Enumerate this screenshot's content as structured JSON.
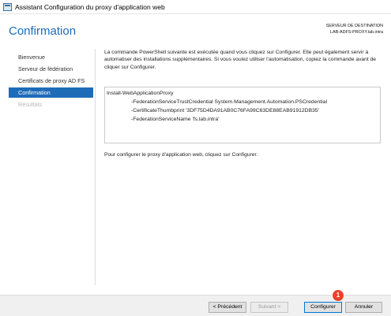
{
  "window": {
    "title": "Assistant Configuration du proxy d'application web"
  },
  "header": {
    "page_title": "Confirmation",
    "destination_label": "SERVEUR DE DESTINATION",
    "destination_server": "LAB-ADFS-PROXY.lab.intra"
  },
  "sidebar": {
    "items": [
      {
        "label": "Bienvenue",
        "state": "normal"
      },
      {
        "label": "Serveur de fédération",
        "state": "normal"
      },
      {
        "label": "Certificats de proxy AD FS",
        "state": "normal"
      },
      {
        "label": "Confirmation",
        "state": "active"
      },
      {
        "label": "Résultats",
        "state": "disabled"
      }
    ]
  },
  "main": {
    "intro_text": "La commande PowerShell suivante est exécutée quand vous cliquez sur Configurer. Elle peut également servir à automatiser des installations supplémentaires. Si vous voulez utiliser l'automatisation, copiez la commande avant de cliquer sur Configurer.",
    "command_lines": [
      "Install-WebApplicationProxy",
      "-FederationServiceTrustCredential System.Management.Automation.PSCredential",
      "-CertificateThumbprint '3DF75D4DA91AB0C76FA99C63DE88EAB91912DB35'",
      "-FederationServiceName 'fs.lab.intra'"
    ],
    "outro_text": "Pour configurer le proxy d'application web, cliquez sur Configurer."
  },
  "footer": {
    "prev_label": "< Précédent",
    "next_label": "Suivant >",
    "configure_label": "Configurer",
    "cancel_label": "Annuler"
  },
  "annotation": {
    "badge_number": "1",
    "badge_color": "#e8432c"
  },
  "colors": {
    "accent": "#1e6bb8"
  }
}
